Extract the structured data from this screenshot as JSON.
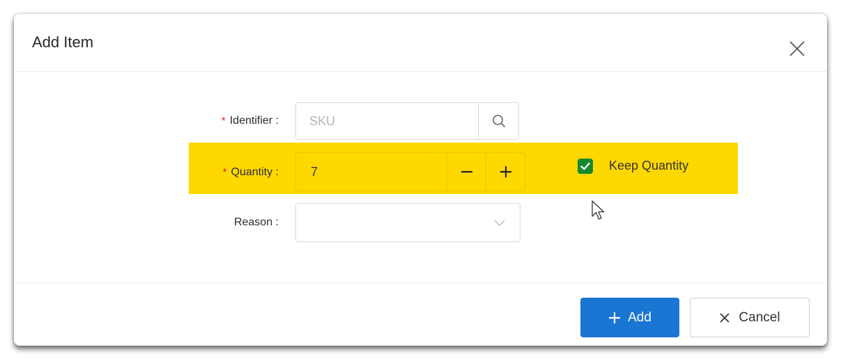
{
  "dialog": {
    "title": "Add Item",
    "close_icon": "close-icon"
  },
  "form": {
    "identifier": {
      "label": "Identifier :",
      "required_mark": "*",
      "placeholder": "SKU",
      "value": "",
      "button_icon": "search-icon"
    },
    "quantity": {
      "label": "Quantity :",
      "required_mark": "*",
      "value": "7",
      "decrement_icon": "minus-icon",
      "increment_icon": "plus-icon",
      "highlight_color": "#ffd800"
    },
    "keep_quantity": {
      "label": "Keep Quantity",
      "checked": true,
      "color": "#168a2e"
    },
    "reason": {
      "label": "Reason :",
      "value": "",
      "icon": "chevron-down-icon"
    }
  },
  "footer": {
    "add_label": "Add",
    "add_icon": "plus-icon",
    "add_color": "#1976d2",
    "cancel_label": "Cancel",
    "cancel_icon": "close-icon"
  },
  "colors": {
    "required": "#e02020"
  }
}
